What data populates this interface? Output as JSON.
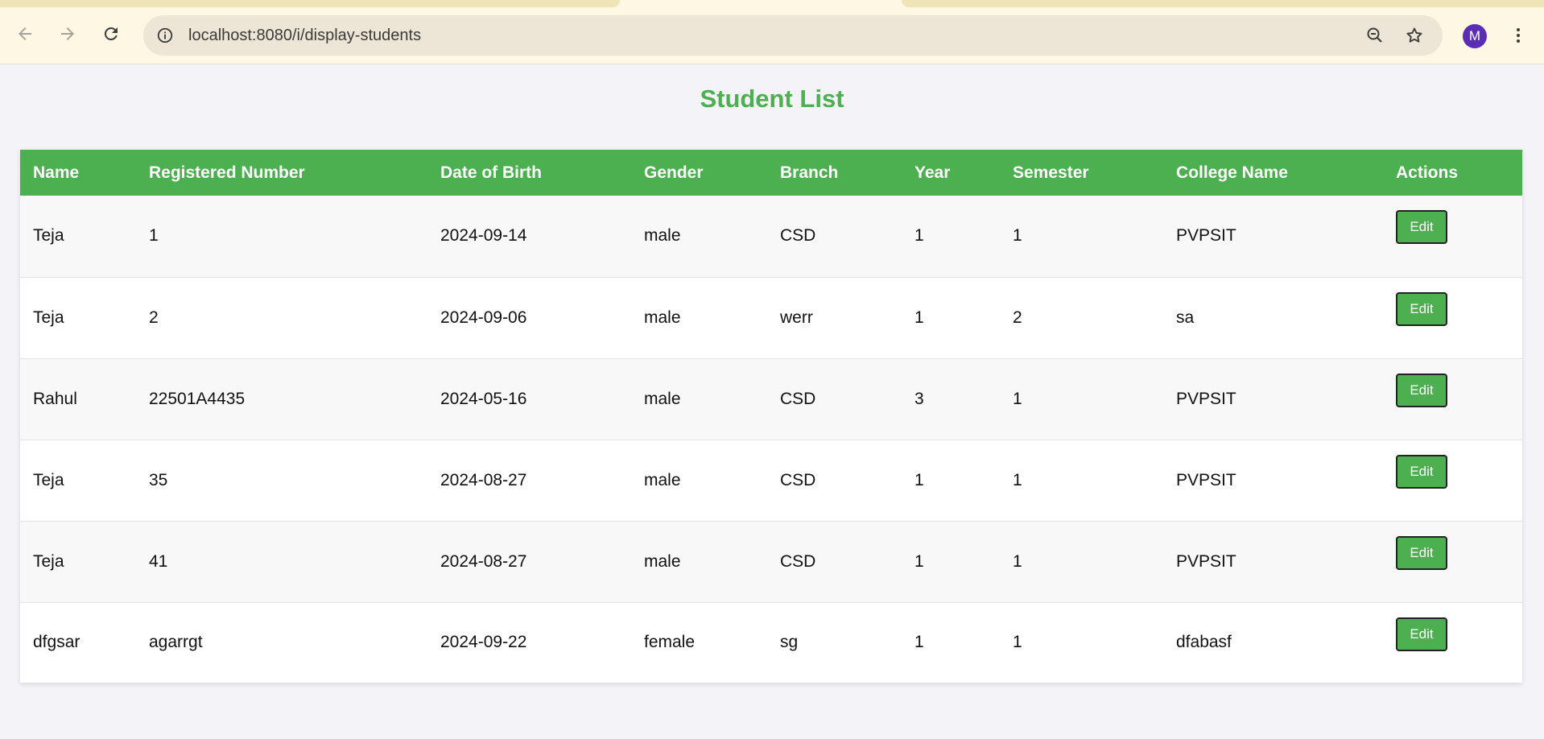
{
  "browser": {
    "url": "localhost:8080/i/display-students",
    "avatar_letter": "M",
    "icons": {
      "back": "back-arrow-icon",
      "forward": "forward-arrow-icon",
      "reload": "reload-icon",
      "site_info": "info-icon",
      "zoom": "zoom-out-icon",
      "bookmark": "star-icon",
      "menu": "kebab-menu-icon"
    }
  },
  "page": {
    "title": "Student List",
    "accent_color": "#4caf50"
  },
  "table": {
    "headers": [
      "Name",
      "Registered Number",
      "Date of Birth",
      "Gender",
      "Branch",
      "Year",
      "Semester",
      "College Name",
      "Actions"
    ],
    "rows": [
      {
        "name": "Teja",
        "reg": "1",
        "dob": "2024-09-14",
        "gender": "male",
        "branch": "CSD",
        "year": "1",
        "semester": "1",
        "college": "PVPSIT",
        "action": "Edit"
      },
      {
        "name": "Teja",
        "reg": "2",
        "dob": "2024-09-06",
        "gender": "male",
        "branch": "werr",
        "year": "1",
        "semester": "2",
        "college": "sa",
        "action": "Edit"
      },
      {
        "name": "Rahul",
        "reg": "22501A4435",
        "dob": "2024-05-16",
        "gender": "male",
        "branch": "CSD",
        "year": "3",
        "semester": "1",
        "college": "PVPSIT",
        "action": "Edit"
      },
      {
        "name": "Teja",
        "reg": "35",
        "dob": "2024-08-27",
        "gender": "male",
        "branch": "CSD",
        "year": "1",
        "semester": "1",
        "college": "PVPSIT",
        "action": "Edit"
      },
      {
        "name": "Teja",
        "reg": "41",
        "dob": "2024-08-27",
        "gender": "male",
        "branch": "CSD",
        "year": "1",
        "semester": "1",
        "college": "PVPSIT",
        "action": "Edit"
      },
      {
        "name": "dfgsar",
        "reg": "agarrgt",
        "dob": "2024-09-22",
        "gender": "female",
        "branch": "sg",
        "year": "1",
        "semester": "1",
        "college": "dfabasf",
        "action": "Edit"
      }
    ]
  }
}
